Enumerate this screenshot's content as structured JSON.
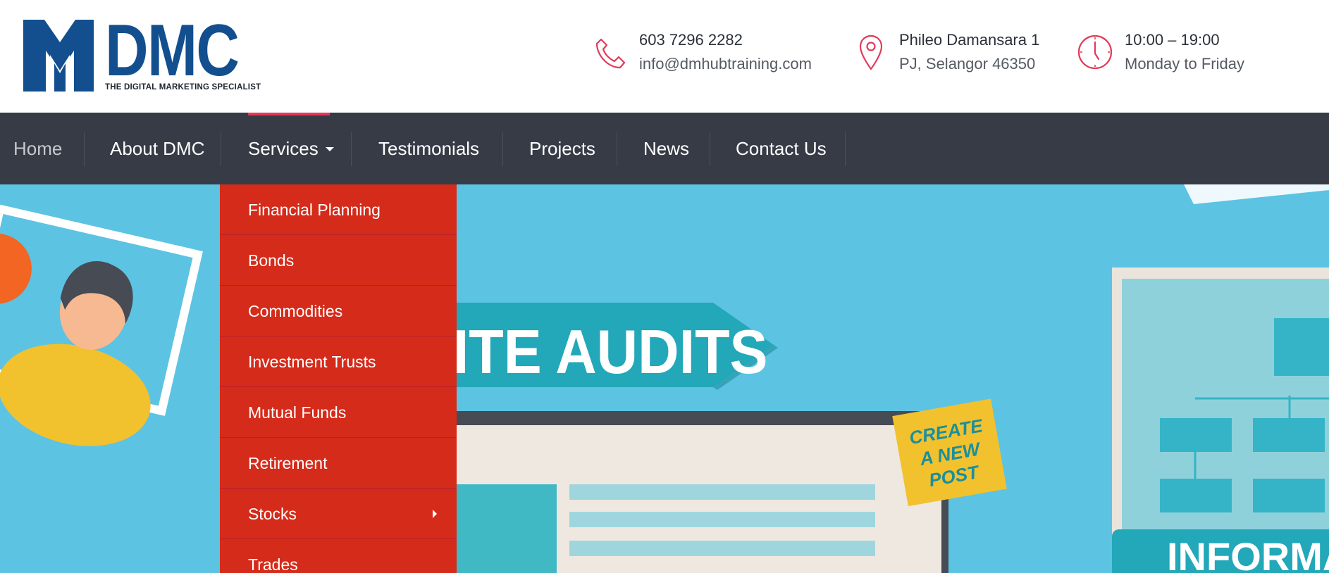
{
  "logo": {
    "wordmark": "DMC",
    "tagline": "THE DIGITAL MARKETING SPECIALIST",
    "colors": {
      "brand": "#134f8f"
    }
  },
  "header": {
    "phone": {
      "icon": "phone-icon",
      "line1": "603 7296 2282",
      "line2": "info@dmhubtraining.com"
    },
    "address": {
      "icon": "map-pin-icon",
      "line1": "Phileo Damansara 1",
      "line2": "PJ, Selangor 46350"
    },
    "hours": {
      "icon": "clock-icon",
      "line1": "10:00 – 19:00",
      "line2": "Monday to Friday"
    }
  },
  "nav": {
    "items": [
      {
        "label": "Home"
      },
      {
        "label": "About DMC"
      },
      {
        "label": "Services",
        "has_dropdown": true,
        "active": true
      },
      {
        "label": "Testimonials"
      },
      {
        "label": "Projects"
      },
      {
        "label": "News"
      },
      {
        "label": "Contact Us"
      }
    ],
    "colors": {
      "bar": "#363b46",
      "active_indicator": "#e23a5a"
    }
  },
  "services_menu": {
    "items": [
      {
        "label": "Financial Planning"
      },
      {
        "label": "Bonds"
      },
      {
        "label": "Commodities"
      },
      {
        "label": "Investment Trusts"
      },
      {
        "label": "Mutual Funds"
      },
      {
        "label": "Retirement"
      },
      {
        "label": "Stocks",
        "has_submenu": true
      },
      {
        "label": "Trades"
      }
    ],
    "colors": {
      "background": "#d52b1a"
    }
  },
  "hero": {
    "banner_text": "SITE AUDITS",
    "note_text": [
      "CREATE",
      "A NEW",
      "POST"
    ],
    "panel_text": "INFORMA",
    "colors": {
      "background": "#5cc3e3",
      "ribbon": "#22a8b8",
      "note": "#f2c12e"
    }
  }
}
